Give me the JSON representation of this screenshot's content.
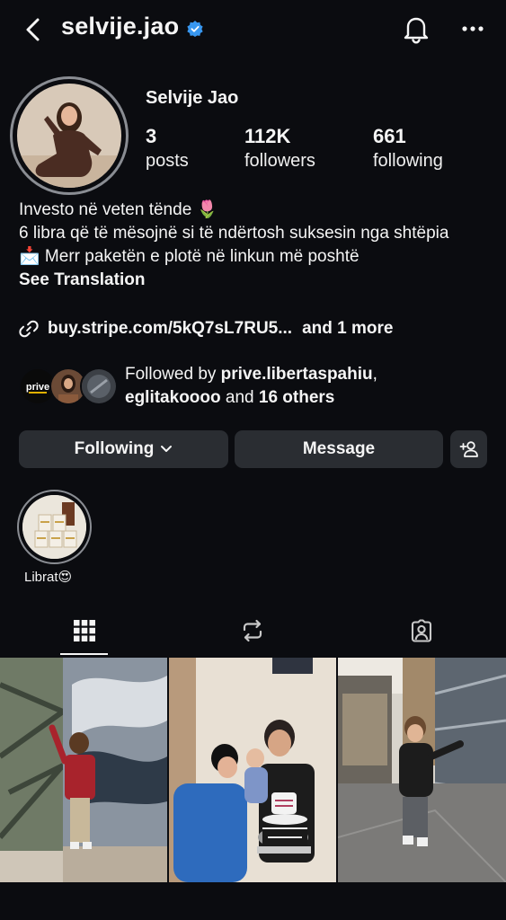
{
  "header": {
    "username": "selvije.jao",
    "icons": {
      "back": "chevron-left-icon",
      "verified": "verified-badge-icon",
      "notifications": "bell-icon",
      "more": "more-horizontal-icon"
    }
  },
  "profile": {
    "display_name": "Selvije Jao",
    "stats": {
      "posts": {
        "value": "3",
        "label": "posts"
      },
      "followers": {
        "value": "112K",
        "label": "followers"
      },
      "following": {
        "value": "661",
        "label": "following"
      }
    },
    "bio": {
      "line1": "Investo në veten tënde 🌷",
      "line2": "6 libra që të mësojnë si të ndërtosh suksesin nga shtëpia",
      "line3": "📩 Merr paketën e plotë në linkun më poshtë",
      "see_translation": "See Translation"
    },
    "link": {
      "url": "buy.stripe.com/5kQ7sL7RU5...",
      "more": "and 1 more"
    },
    "mutual": {
      "prefix": "Followed by ",
      "user1": "prive.libertaspahiu",
      "sep": ",",
      "user2": "eglitakoooo",
      "and": " and ",
      "others": "16 others"
    }
  },
  "actions": {
    "following": "Following",
    "message": "Message"
  },
  "highlights": [
    {
      "label": "Librat😍"
    }
  ],
  "tabs": [
    {
      "icon": "grid-icon",
      "active": true
    },
    {
      "icon": "reels-icon"
    },
    {
      "icon": "tagged-icon"
    }
  ],
  "colors": {
    "background": "#0b0c10",
    "button": "#2a2d32",
    "verified": "#3897f0",
    "text": "#f5f5f5"
  }
}
